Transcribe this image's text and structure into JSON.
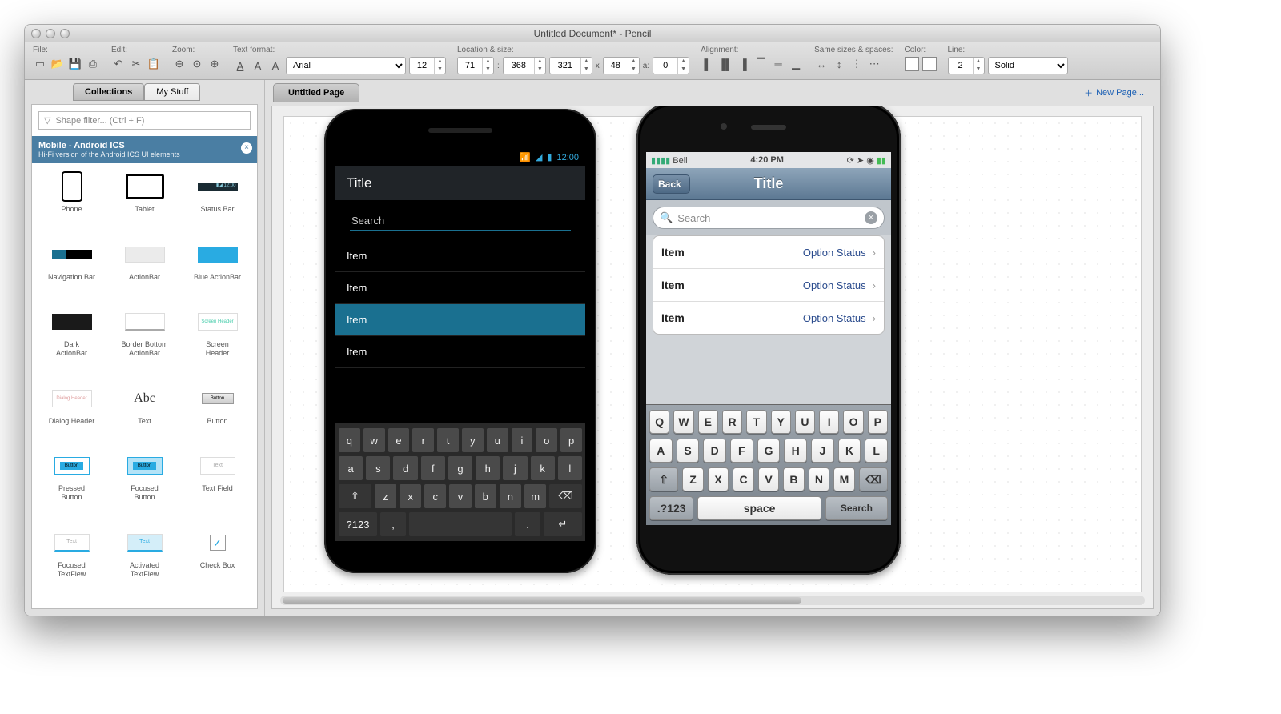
{
  "window_title": "Untitled Document* - Pencil",
  "toolbar": {
    "file": {
      "label": "File:"
    },
    "edit": {
      "label": "Edit:"
    },
    "zoom": {
      "label": "Zoom:"
    },
    "text_format": {
      "label": "Text format:",
      "font": "Arial",
      "size": "12"
    },
    "loc": {
      "label": "Location & size:",
      "x": "71",
      "y": "368",
      "w": "321",
      "h": "48",
      "a": "0"
    },
    "align": {
      "label": "Alignment:"
    },
    "sizes": {
      "label": "Same sizes & spaces:"
    },
    "color": {
      "label": "Color:"
    },
    "line": {
      "label": "Line:",
      "w": "2",
      "style": "Solid"
    }
  },
  "side_tabs": {
    "collections": "Collections",
    "mystuff": "My Stuff"
  },
  "filter_placeholder": "Shape filter... (Ctrl + F)",
  "collection": {
    "title": "Mobile - Android ICS",
    "sub": "Hi-Fi version of the Android ICS UI elements"
  },
  "shapes": [
    "Phone",
    "Tablet",
    "Status Bar",
    "Navigation Bar",
    "ActionBar",
    "Blue ActionBar",
    "Dark ActionBar",
    "Border Bottom ActionBar",
    "Screen Header",
    "Dialog Header",
    "Text",
    "Button",
    "Pressed Button",
    "Focused Button",
    "Text Field",
    "Focused TextFiew",
    "Activated TextFiew",
    "Check Box"
  ],
  "page_tab": "Untitled Page",
  "new_page": "New Page...",
  "android": {
    "time": "12:00",
    "title": "Title",
    "search": "Search",
    "items": [
      "Item",
      "Item",
      "Item",
      "Item"
    ],
    "kbd": {
      "r1": [
        "q",
        "w",
        "e",
        "r",
        "t",
        "y",
        "u",
        "i",
        "o",
        "p"
      ],
      "r2": [
        "a",
        "s",
        "d",
        "f",
        "g",
        "h",
        "j",
        "k",
        "l"
      ],
      "r3": [
        "⇧",
        "z",
        "x",
        "c",
        "v",
        "b",
        "n",
        "m",
        "⌫"
      ],
      "r4": [
        "?123",
        ",",
        "",
        ".",
        " ↵"
      ]
    }
  },
  "ios": {
    "carrier": "Bell",
    "time": "4:20 PM",
    "back": "Back",
    "title": "Title",
    "search": "Search",
    "items": [
      {
        "l": "Item",
        "r": "Option Status"
      },
      {
        "l": "Item",
        "r": "Option Status"
      },
      {
        "l": "Item",
        "r": "Option Status"
      }
    ],
    "kbd": {
      "r1": [
        "Q",
        "W",
        "E",
        "R",
        "T",
        "Y",
        "U",
        "I",
        "O",
        "P"
      ],
      "r2": [
        "A",
        "S",
        "D",
        "F",
        "G",
        "H",
        "J",
        "K",
        "L"
      ],
      "r3": [
        "⇧",
        "Z",
        "X",
        "C",
        "V",
        "B",
        "N",
        "M",
        "⌫"
      ],
      "r4": [
        ".?123",
        "space",
        "Search"
      ]
    }
  }
}
